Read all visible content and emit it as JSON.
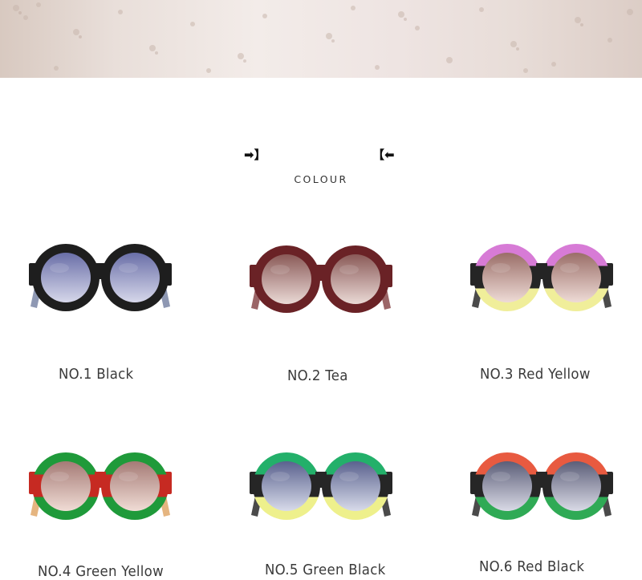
{
  "header": {
    "left_bracket": "➡】",
    "right_bracket": "【⬅",
    "title": "COLOUR"
  },
  "products": [
    {
      "label": "NO.1 Black",
      "frame_top": "#1e1e1e",
      "frame_mid": "#1e1e1e",
      "frame_bottom": "#1e1e1e",
      "lens_top": "#6a6fa8",
      "lens_bottom": "#d6d7ea",
      "temple": "#7a86a6"
    },
    {
      "label": "NO.2 Tea",
      "frame_top": "#6a2226",
      "frame_mid": "#6a2226",
      "frame_bottom": "#6a2226",
      "lens_top": "#8a5a58",
      "lens_bottom": "#ead9d5",
      "temple": "#8a4a4c"
    },
    {
      "label": "NO.3 Red Yellow",
      "frame_top": "#d77bd6",
      "frame_mid": "#252525",
      "frame_bottom": "#f0ee9a",
      "lens_top": "#9a6e68",
      "lens_bottom": "#eedbd6",
      "temple": "#2a2a2a"
    },
    {
      "label": "NO.4 Green Yellow",
      "frame_top": "#1f9a3a",
      "frame_mid": "#c62a22",
      "frame_bottom": "#1f9a3a",
      "lens_top": "#a57b76",
      "lens_bottom": "#f0dcd5",
      "temple": "#e0a86a"
    },
    {
      "label": "NO.5 Green Black",
      "frame_top": "#23b06a",
      "frame_mid": "#262626",
      "frame_bottom": "#eef08c",
      "lens_top": "#5a628e",
      "lens_bottom": "#d8dbea",
      "temple": "#2a2a2a"
    },
    {
      "label": "NO.6 Red Black",
      "frame_top": "#e85a40",
      "frame_mid": "#262626",
      "frame_bottom": "#2faa55",
      "lens_top": "#5c5e78",
      "lens_bottom": "#d9dae6",
      "temple": "#2a2a2a"
    }
  ]
}
